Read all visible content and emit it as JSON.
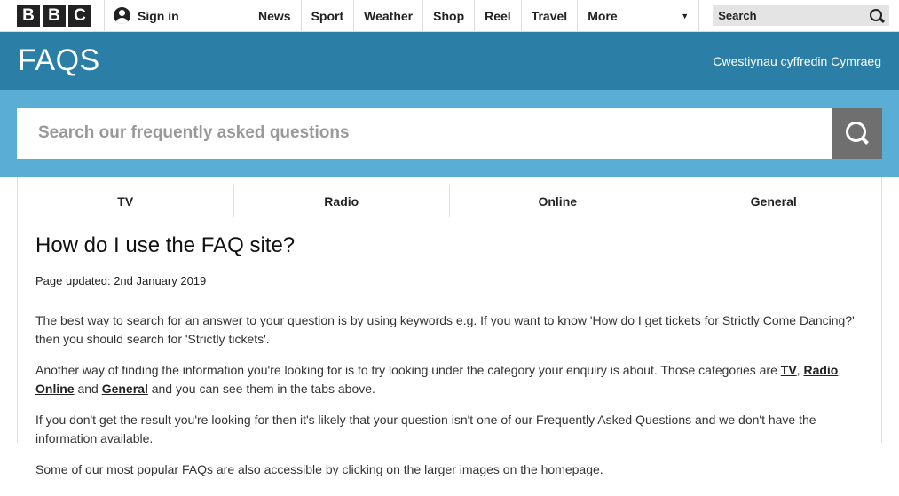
{
  "brand": {
    "letters": [
      "B",
      "B",
      "C"
    ]
  },
  "topnav": {
    "signin_label": "Sign in",
    "links": [
      "News",
      "Sport",
      "Weather",
      "Shop",
      "Reel",
      "Travel"
    ],
    "more_label": "More",
    "search_label": "Search"
  },
  "faq_header": {
    "title": "FAQS",
    "welsh_link": "Cwestiynau cyffredin Cymraeg"
  },
  "search": {
    "placeholder": "Search our frequently asked questions"
  },
  "tabs": [
    "TV",
    "Radio",
    "Online",
    "General"
  ],
  "article": {
    "title": "How do I use the FAQ site?",
    "updated": "Page updated: 2nd January 2019",
    "p1": "The best way to search for an answer to your question is by using keywords e.g. If you want to know 'How do I get tickets for Strictly Come Dancing?' then you should search for 'Strictly tickets'.",
    "p2_before": "Another way of finding the information you're looking for is to try looking under the category your enquiry is about. Those categories are ",
    "p2_links": [
      "TV",
      "Radio",
      "Online",
      "General"
    ],
    "p2_sep1": ", ",
    "p2_sep2": ", ",
    "p2_sep3": " and ",
    "p2_after": " and you can see them in the tabs above.",
    "p3": "If you don't get the result you're looking for then it's likely that your question isn't one of our Frequently Asked Questions and we don't have the information available.",
    "p4": "Some of our most popular FAQs are also accessible by clicking on the larger images on the homepage."
  },
  "colors": {
    "header_blue": "#2b7fa6",
    "search_band_blue": "#5aaed6",
    "search_button_grey": "#6f6f6f"
  },
  "icons": [
    "user-icon",
    "search-icon",
    "chevron-down-icon"
  ]
}
